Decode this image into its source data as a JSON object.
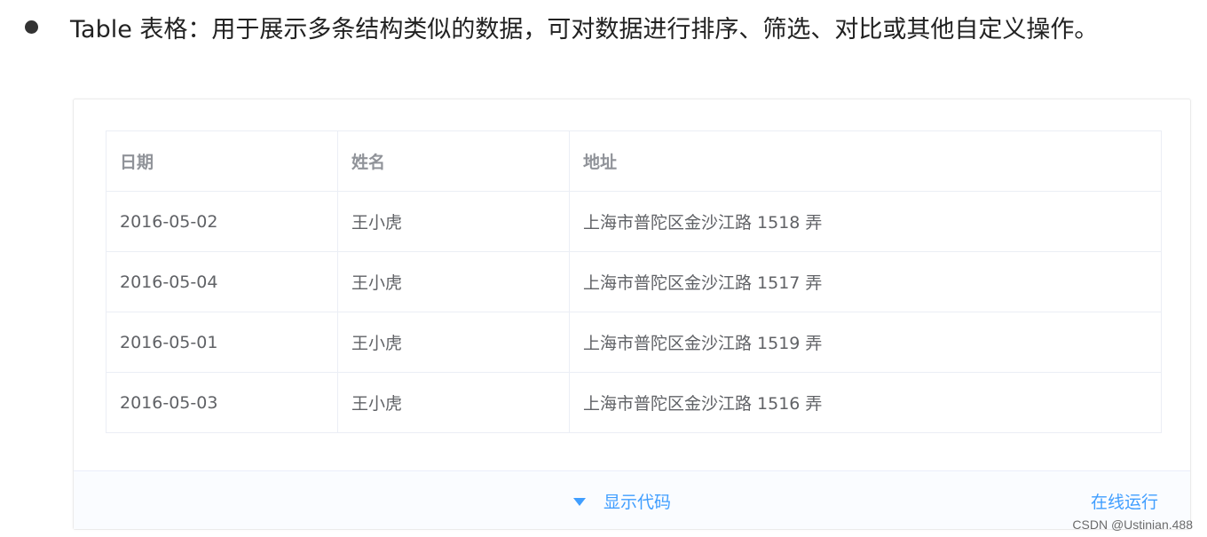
{
  "bullet": {
    "text": "Table 表格：用于展示多条结构类似的数据，可对数据进行排序、筛选、对比或其他自定义操作。"
  },
  "table": {
    "headers": [
      "日期",
      "姓名",
      "地址"
    ],
    "rows": [
      [
        "2016-05-02",
        "王小虎",
        "上海市普陀区金沙江路 1518 弄"
      ],
      [
        "2016-05-04",
        "王小虎",
        "上海市普陀区金沙江路 1517 弄"
      ],
      [
        "2016-05-01",
        "王小虎",
        "上海市普陀区金沙江路 1519 弄"
      ],
      [
        "2016-05-03",
        "王小虎",
        "上海市普陀区金沙江路 1516 弄"
      ]
    ]
  },
  "controls": {
    "toggle_icon": "caret-down-icon",
    "show_code_label": "显示代码",
    "run_online_label": "在线运行"
  },
  "watermark": "CSDN @Ustinian.488",
  "colors": {
    "accent": "#409eff",
    "header_text": "#909399",
    "cell_text": "#606266",
    "border": "#ebeef5"
  }
}
